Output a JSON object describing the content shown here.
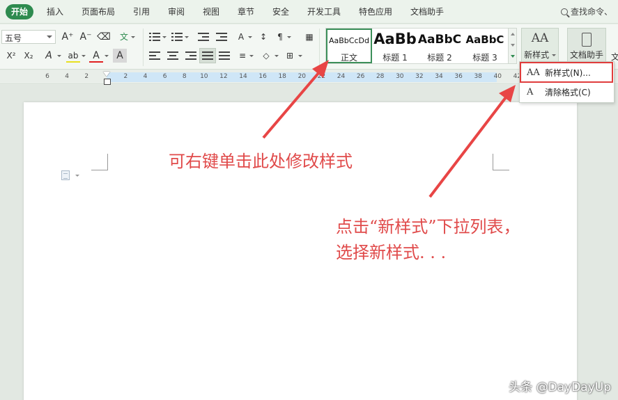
{
  "tabs": [
    {
      "label": "开始",
      "active": true
    },
    {
      "label": "插入"
    },
    {
      "label": "页面布局"
    },
    {
      "label": "引用"
    },
    {
      "label": "审阅"
    },
    {
      "label": "视图"
    },
    {
      "label": "章节"
    },
    {
      "label": "安全"
    },
    {
      "label": "开发工具"
    },
    {
      "label": "特色应用"
    },
    {
      "label": "文档助手"
    }
  ],
  "search": {
    "label": "查找命令、"
  },
  "font": {
    "size_value": "五号"
  },
  "toolbar_glyphs": {
    "grow": "A⁺",
    "shrink": "A⁻",
    "clear": "⌫",
    "pinyin": "文",
    "superscript": "X²",
    "subscript": "X₂",
    "effects": "A",
    "highlight": "ab",
    "font_color": "A",
    "char_shading": "A"
  },
  "styles": [
    {
      "preview": "AaBbCcDd",
      "label": "正文",
      "selected": true
    },
    {
      "preview": "AaBb",
      "label": "标题 1"
    },
    {
      "preview": "AaBbC",
      "label": "标题 2"
    },
    {
      "preview": "AaBbC",
      "label": "标题 3"
    }
  ],
  "new_style": {
    "label": "新样式",
    "icon_text": "AA"
  },
  "doc_assistant": {
    "label": "文档助手"
  },
  "edge_char": "文",
  "ruler": {
    "ticks": [
      "6",
      "4",
      "2",
      "2",
      "4",
      "6",
      "8",
      "10",
      "12",
      "14",
      "16",
      "18",
      "20",
      "22",
      "24",
      "26",
      "28",
      "30",
      "32",
      "34",
      "36",
      "38",
      "40",
      "42"
    ]
  },
  "menu": {
    "items": [
      {
        "label": "新样式(N)...",
        "icon": "AA"
      },
      {
        "label": "清除格式(C)",
        "icon": "A"
      }
    ]
  },
  "annotations": {
    "left": "可右键单击此处修改样式",
    "right_line1": "点击“新样式”下拉列表，",
    "right_line2": "选择新样式. . ."
  },
  "watermark": "头条 @DayDayUp",
  "colors": {
    "accent": "#2e8b4f",
    "annotation": "#e04a4a",
    "highlight_box": "#e03c3c"
  }
}
